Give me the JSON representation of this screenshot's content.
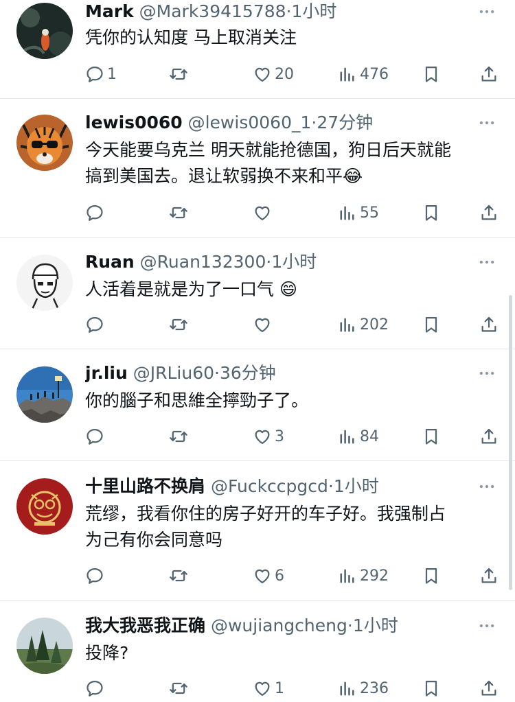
{
  "tweets": [
    {
      "name": "Mark",
      "handle": "@Mark39415788",
      "time": "1小时",
      "text": "凭你的认知度 马上取消关注",
      "text2": "",
      "emoji": "",
      "replies": "1",
      "retweets": "",
      "likes": "20",
      "views": "476"
    },
    {
      "name": "lewis0060",
      "handle": "@lewis0060_1",
      "time": "27分钟",
      "text": "今天能要乌克兰 明天就能抢德国，狗日后天就能",
      "text2": "搞到美国去。退让软弱换不来和平",
      "emoji": "😂",
      "replies": "",
      "retweets": "",
      "likes": "",
      "views": "55"
    },
    {
      "name": "Ruan",
      "handle": "@Ruan132300",
      "time": "1小时",
      "text": "人活着是就是为了一口气",
      "text2": "",
      "emoji": "😄",
      "replies": "",
      "retweets": "",
      "likes": "",
      "views": "202"
    },
    {
      "name": "jr.liu",
      "handle": "@JRLiu60",
      "time": "36分钟",
      "text": "你的腦子和思維全擰勁子了。",
      "text2": "",
      "emoji": "",
      "replies": "",
      "retweets": "",
      "likes": "3",
      "views": "84"
    },
    {
      "name": "十里山路不换肩",
      "handle": "@Fuckccpgcd",
      "time": "1小时",
      "text": "荒缪，我看你住的房子好开的车子好。我强制占",
      "text2": "为己有你会同意吗",
      "emoji": "",
      "replies": "",
      "retweets": "",
      "likes": "6",
      "views": "292"
    },
    {
      "name": "我大我恶我正确",
      "handle": "@wujiangcheng",
      "time": "1小时",
      "text": "投降?",
      "text2": "",
      "emoji": "",
      "replies": "",
      "retweets": "",
      "likes": "1",
      "views": "236"
    }
  ],
  "separator": "·",
  "icons": {
    "reply": "reply-icon",
    "retweet": "retweet-icon",
    "like": "heart-icon",
    "views": "views-icon",
    "bookmark": "bookmark-icon",
    "share": "share-icon",
    "more": "more-icon"
  },
  "colors": {
    "text": "#0f1419",
    "secondary": "#536471",
    "divider": "#e6e9ec"
  }
}
